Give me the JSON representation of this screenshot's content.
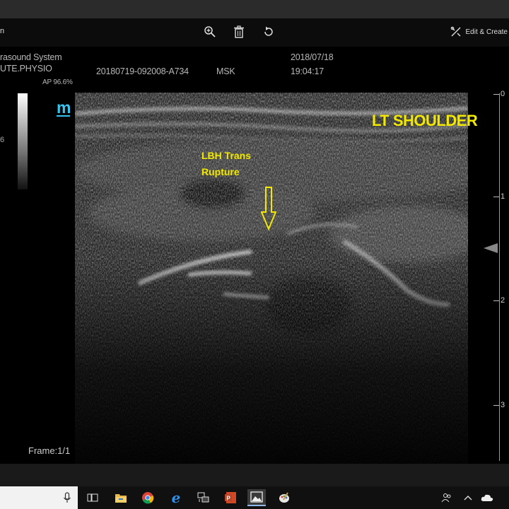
{
  "toolbar": {
    "left_text": "n",
    "icons": [
      "zoom-in-icon",
      "trash-icon",
      "rotate-icon"
    ],
    "edit_create_label": "Edit & Create"
  },
  "viewer_header": {
    "system": "rasound System",
    "institute": "UTE.PHYSIO",
    "ap": "AP 96.6%",
    "patient_id": "20180719-092008-A734",
    "preset": "MSK",
    "date": "2018/07/18",
    "time": "19:04:17",
    "scale_value": "6",
    "logo": "m"
  },
  "annotations": {
    "location": "LT SHOULDER",
    "finding_line1": "LBH Trans",
    "finding_line2": "Rupture"
  },
  "depth_scale": {
    "labels": [
      "0",
      "1",
      "2",
      "3"
    ]
  },
  "frame": "Frame:1/1",
  "colors": {
    "annotation": "#f2e800",
    "logo": "#39c4f0"
  },
  "taskbar": {
    "apps": [
      "cortana-icon",
      "task-view-icon",
      "file-explorer-icon",
      "chrome-icon",
      "edge-icon",
      "network-icon",
      "powerpoint-icon",
      "photos-icon",
      "paint-icon"
    ],
    "tray": [
      "people-icon",
      "chevron-up-icon",
      "cloud-icon"
    ]
  }
}
